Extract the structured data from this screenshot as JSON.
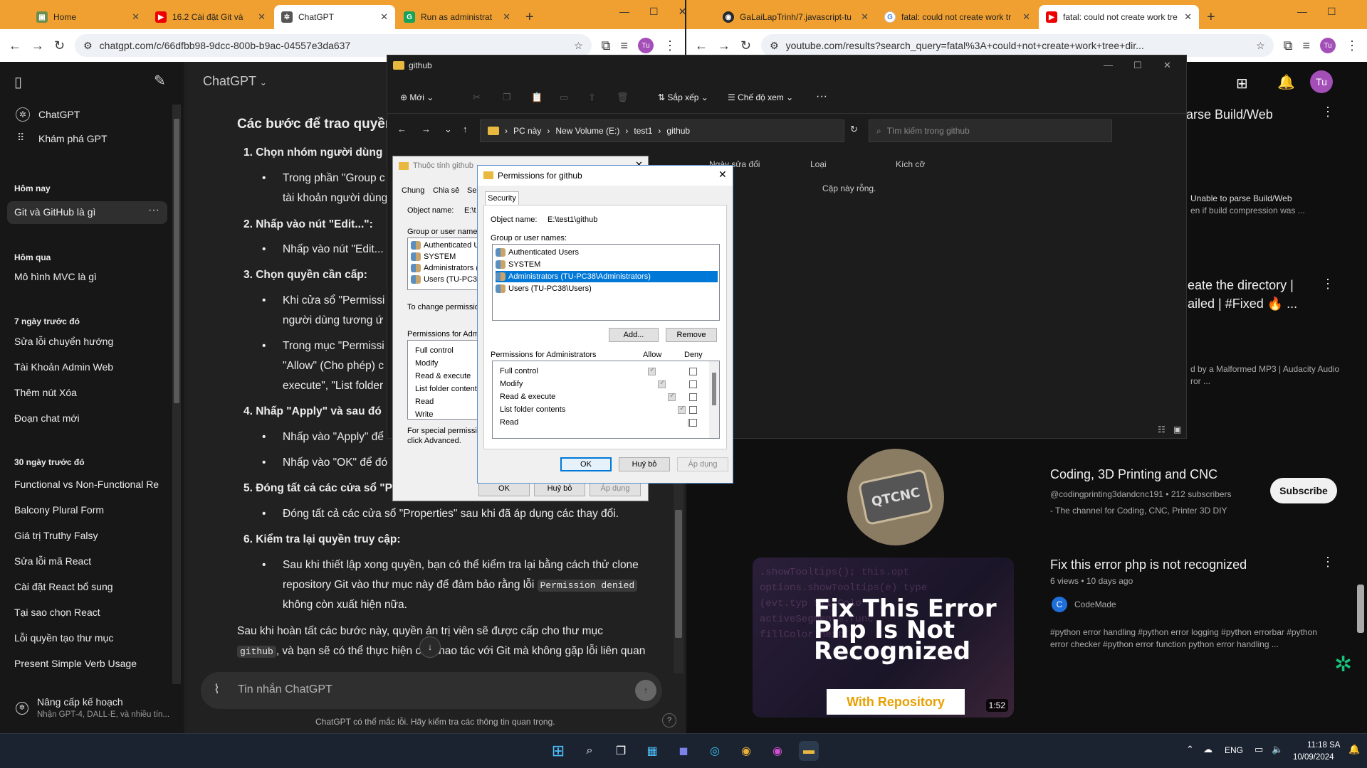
{
  "left_browser": {
    "tabs": [
      {
        "title": "Home",
        "icon": "notion-icon"
      },
      {
        "title": "16.2 Cài đặt Git và",
        "icon": "youtube-icon"
      },
      {
        "title": "ChatGPT",
        "icon": "chatgpt-icon"
      },
      {
        "title": "Run as administrat",
        "icon": "grammarly-icon"
      }
    ],
    "url": "chatgpt.com/c/66dfbb98-9dcc-800b-b9ac-04557e3da637",
    "profile": "Tu"
  },
  "right_browser": {
    "tabs": [
      {
        "title": "GaLaiLapTrinh/7.javascript-tu",
        "icon": "github-icon"
      },
      {
        "title": "fatal: could not create work tr",
        "icon": "google-icon"
      },
      {
        "title": "fatal: could not create work tre",
        "icon": "youtube-icon"
      }
    ],
    "url": "youtube.com/results?search_query=fatal%3A+could+not+create+work+tree+dir...",
    "profile": "Tu"
  },
  "chatgpt": {
    "header_title": "ChatGPT",
    "nav": [
      {
        "label": "ChatGPT"
      },
      {
        "label": "Khám phá GPT"
      }
    ],
    "groups": [
      {
        "heading": "Hôm nay",
        "items": [
          "Git và GitHub là gì"
        ]
      },
      {
        "heading": "Hôm qua",
        "items": [
          "Mô hình MVC là gì"
        ]
      },
      {
        "heading": "7 ngày trước đó",
        "items": [
          "Sửa lỗi chuyển hướng",
          "Tài Khoản Admin Web",
          "Thêm nút Xóa",
          "Đoạn chat mới"
        ]
      },
      {
        "heading": "30 ngày trước đó",
        "items": [
          "Functional vs Non-Functional Re",
          "Balcony Plural Form",
          "Giá trị Truthy Falsy",
          "Sửa lỗi mã React",
          "Cài đặt React bổ sung",
          "Tại sao chọn React",
          "Lỗi quyền tạo thư mục",
          "Present Simple Verb Usage"
        ]
      }
    ],
    "upgrade": {
      "title": "Nâng cấp kế hoạch",
      "subtitle": "Nhận GPT-4, DALL·E, và nhiều tín..."
    },
    "content": {
      "heading": "Các bước để trao quyền",
      "s1": "1.  Chọn nhóm người dùng",
      "s1b1": "Trong phần \"Group c",
      "s1b1b": "tài khoản người dùng",
      "s2": "2.  Nhấp vào nút \"Edit...\":",
      "s2b1": "Nhấp vào nút \"Edit...",
      "s3": "3.  Chọn quyền cần cấp:",
      "s3b1": "Khi cửa sổ \"Permissi",
      "s3b1b": "người dùng tương ứ",
      "s3b2": "Trong mục \"Permissi",
      "s3b2b": "\"Allow\" (Cho phép) c",
      "s3b2c": "execute\", \"List folder",
      "s4": "4.  Nhấp \"Apply\" và sau đó",
      "s4b1": "Nhấp vào \"Apply\" để",
      "s4b2": "Nhấp vào \"OK\" để đó",
      "s5": "5.  Đóng tất cả các cửa sổ \"P",
      "s5b1": "Đóng tất cả các cửa sổ \"Properties\" sau khi đã áp dụng các thay đổi.",
      "s6": "6.  Kiểm tra lại quyền truy cập:",
      "s6b1": "Sau khi thiết lập xong quyền, bạn có thể kiểm tra lại bằng cách thử clone",
      "s6b1b_pre": "repository Git vào thư mục này để đảm bảo rằng lỗi",
      "s6b1b_code": "Permission denied",
      "s6b1c": "không còn xuất hiện nữa.",
      "p1": "Sau khi hoàn tất các bước này, quyền   ản trị viên sẽ được cấp cho thư mục",
      "p2_code": "github",
      "p2": ", và bạn sẽ có thể thực hiện các thao tác với Git mà không gặp lỗi liên quan"
    },
    "input_placeholder": "Tin nhắn ChatGPT",
    "disclaimer": "ChatGPT có thể mắc lỗi. Hãy kiểm tra các thông tin quan trọng."
  },
  "explorer": {
    "title": "github",
    "toolbar": {
      "new": "Mới",
      "sort": "Sắp xếp",
      "view": "Chế độ xem"
    },
    "breadcrumb": [
      "PC này",
      "New Volume (E:)",
      "test1",
      "github"
    ],
    "search_placeholder": "Tìm kiếm trong github",
    "columns": [
      "Ngày sửa đổi",
      "Loại",
      "Kích cỡ"
    ],
    "empty": "Cặp này rỗng."
  },
  "properties_dialog": {
    "title": "Thuộc tính github",
    "tabs": [
      "Chung",
      "Chia sẻ",
      "Se"
    ],
    "object_label": "Object name:",
    "object_value": "E:\\t",
    "group_label": "Group or user names:",
    "users": [
      "Authenticated U",
      "SYSTEM",
      "Administrators (",
      "Users (TU-PC38"
    ],
    "change_text": "To change permissio",
    "perm_label": "Permissions for Admir",
    "perms": [
      "Full control",
      "Modify",
      "Read & execute",
      "List folder contents",
      "Read",
      "Write"
    ],
    "special1": "For special permissio",
    "special2": "click Advanced.",
    "buttons": [
      "OK",
      "Huỷ bỏ",
      "Áp dụng"
    ]
  },
  "permissions_dialog": {
    "title": "Permissions for github",
    "tab": "Security",
    "object_label": "Object name:",
    "object_value": "E:\\test1\\github",
    "group_label": "Group or user names:",
    "users": [
      "Authenticated Users",
      "SYSTEM",
      "Administrators (TU-PC38\\Administrators)",
      "Users (TU-PC38\\Users)"
    ],
    "add": "Add...",
    "remove": "Remove",
    "perm_label": "Permissions for Administrators",
    "allow": "Allow",
    "deny": "Deny",
    "perms": [
      "Full control",
      "Modify",
      "Read & execute",
      "List folder contents",
      "Read"
    ],
    "ok": "OK",
    "cancel": "Huỷ bỏ",
    "apply": "Áp dụng"
  },
  "youtube": {
    "r1_title": "arse Build/Web",
    "r1_desc1": "Unable to parse Build/Web",
    "r1_desc2": "en if build compression was ...",
    "r2_title1": "eate the directory |",
    "r2_title2": "ailed | #Fixed 🔥 ...",
    "r2_desc1": "d by a Malformed MP3 | Audacity Audio",
    "r2_desc2": "ror  ...",
    "channel_name": "Coding, 3D Printing and CNC",
    "channel_meta": "@codingprinting3dandcnc191 • 212 subscribers",
    "channel_desc": "- The channel for Coding, CNC, Printer 3D DIY",
    "channel_logo": "QTCNC",
    "subscribe": "Subscribe",
    "video_title": "Fix this error php is not recognized",
    "video_meta": "6 views • 10 days ago",
    "video_channel": "CodeMade",
    "video_channel_initial": "C",
    "video_tags1": "#python error handling #python error logging #python errorbar #python",
    "video_tags2": "error checker #python error function python error handling ...",
    "thumb_line1": "Fix This Error",
    "thumb_line2": "Php Is Not",
    "thumb_line3": "Recognized",
    "thumb_banner": "With Repository",
    "duration": "1:52"
  },
  "taskbar": {
    "lang": "ENG",
    "time": "11:18 SA",
    "date": "10/09/2024"
  }
}
